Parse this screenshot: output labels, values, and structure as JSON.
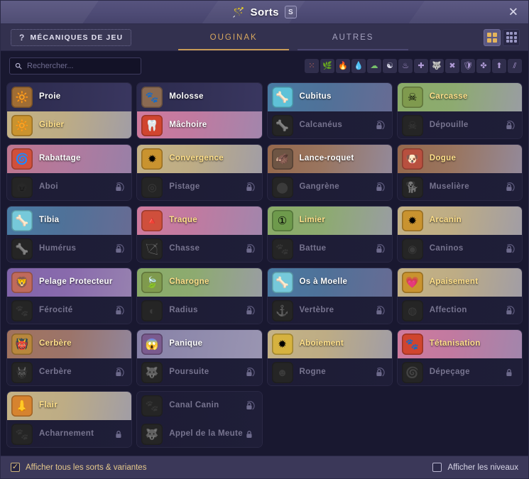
{
  "window": {
    "title": "Sorts",
    "shortcut_key": "S",
    "wand_icon": "magic-wand-icon",
    "close_icon": "✕"
  },
  "tabbar": {
    "mechanics_label": "MÉCANIQUES DE JEU",
    "mechanics_icon": "?",
    "tabs": [
      {
        "label": "OUGINAK",
        "active": true
      },
      {
        "label": "AUTRES",
        "active": false
      }
    ],
    "view_modes": [
      {
        "name": "grid-large-view",
        "active": true
      },
      {
        "name": "grid-small-view",
        "active": false
      }
    ]
  },
  "search": {
    "placeholder": "Rechercher...",
    "value": "",
    "icon": "search-icon"
  },
  "element_filters": [
    {
      "name": "all-elements-filter",
      "glyph": "⁙",
      "color": "#cf6f5a"
    },
    {
      "name": "earth-element-filter",
      "glyph": "🌿",
      "color": "#a98c46"
    },
    {
      "name": "fire-element-filter",
      "glyph": "🔥",
      "color": "#e06a33"
    },
    {
      "name": "water-element-filter",
      "glyph": "💧",
      "color": "#63c8e8"
    },
    {
      "name": "air-element-filter",
      "glyph": "☁",
      "color": "#76c06a"
    },
    {
      "name": "neutral-element-filter",
      "glyph": "☯",
      "color": "#d8d8e8"
    },
    {
      "name": "heal-filter",
      "glyph": "♨",
      "color": "#b09bd6"
    },
    {
      "name": "buff-filter",
      "glyph": "✚",
      "color": "#b09bd6"
    },
    {
      "name": "summon-filter",
      "glyph": "🐺",
      "color": "#b09bd6"
    },
    {
      "name": "debuff-filter",
      "glyph": "✖",
      "color": "#b09bd6"
    },
    {
      "name": "shield-filter",
      "glyph": "🛡",
      "color": "#b09bd6"
    },
    {
      "name": "movement-filter",
      "glyph": "✤",
      "color": "#b09bd6"
    },
    {
      "name": "push-filter",
      "glyph": "⬆",
      "color": "#b09bd6"
    },
    {
      "name": "damage-filter",
      "glyph": "⫽",
      "color": "#b09bd6"
    }
  ],
  "spells": [
    {
      "top": {
        "label": "Proie",
        "unlocked": true,
        "style": "night",
        "icon": "🔆",
        "icon_bg": "#a06d34",
        "gold": false
      },
      "bottom": {
        "label": "Gibier",
        "unlocked": true,
        "style": "sand",
        "icon": "🔆",
        "icon_bg": "#c9932f",
        "gold": true
      }
    },
    {
      "top": {
        "label": "Molosse",
        "unlocked": true,
        "style": "night",
        "icon": "🐾",
        "icon_bg": "#8a6a52",
        "gold": false
      },
      "bottom": {
        "label": "Mâchoire",
        "unlocked": true,
        "style": "pink",
        "icon": "🦷",
        "icon_bg": "#d0452f",
        "gold": false
      }
    },
    {
      "top": {
        "label": "Cubitus",
        "unlocked": true,
        "style": "ice",
        "icon": "🦴",
        "icon_bg": "#5fc2d8",
        "gold": false
      },
      "bottom": {
        "label": "Calcanéus",
        "unlocked": false,
        "style": "dark",
        "icon": "🦴",
        "icon_bg": "#43415f",
        "gold": false
      }
    },
    {
      "top": {
        "label": "Carcasse",
        "unlocked": true,
        "style": "green",
        "icon": "☠",
        "icon_bg": "#7f9a4e",
        "gold": true
      },
      "bottom": {
        "label": "Dépouille",
        "unlocked": false,
        "style": "dark",
        "icon": "☠",
        "icon_bg": "#43415f",
        "gold": false
      }
    },
    {
      "top": {
        "label": "Rabattage",
        "unlocked": true,
        "style": "rose",
        "icon": "🌀",
        "icon_bg": "#d0503c",
        "gold": false
      },
      "bottom": {
        "label": "Aboi",
        "unlocked": false,
        "style": "dark",
        "icon": "😈",
        "icon_bg": "#43415f",
        "gold": false
      }
    },
    {
      "top": {
        "label": "Convergence",
        "unlocked": true,
        "style": "sand",
        "icon": "✹",
        "icon_bg": "#c9932f",
        "gold": true
      },
      "bottom": {
        "label": "Pistage",
        "unlocked": false,
        "style": "dark",
        "icon": "◎",
        "icon_bg": "#43415f",
        "gold": false
      }
    },
    {
      "top": {
        "label": "Lance-roquet",
        "unlocked": true,
        "style": "brown",
        "icon": "🐗",
        "icon_bg": "#6e5544",
        "gold": false
      },
      "bottom": {
        "label": "Gangrène",
        "unlocked": false,
        "style": "dark",
        "icon": "⬤",
        "icon_bg": "#43415f",
        "gold": false
      }
    },
    {
      "top": {
        "label": "Dogue",
        "unlocked": true,
        "style": "brown",
        "icon": "🐶",
        "icon_bg": "#b8503f",
        "gold": true
      },
      "bottom": {
        "label": "Muselière",
        "unlocked": false,
        "style": "dark",
        "icon": "🐕",
        "icon_bg": "#43415f",
        "gold": false
      }
    },
    {
      "top": {
        "label": "Tibia",
        "unlocked": true,
        "style": "ice",
        "icon": "🦴",
        "icon_bg": "#76c9da",
        "gold": false
      },
      "bottom": {
        "label": "Humérus",
        "unlocked": false,
        "style": "dark",
        "icon": "🦴",
        "icon_bg": "#43415f",
        "gold": false
      }
    },
    {
      "top": {
        "label": "Traque",
        "unlocked": true,
        "style": "pink",
        "icon": "🔺",
        "icon_bg": "#cf4f3c",
        "gold": true
      },
      "bottom": {
        "label": "Chasse",
        "unlocked": false,
        "style": "dark",
        "icon": "🏹",
        "icon_bg": "#43415f",
        "gold": false
      }
    },
    {
      "top": {
        "label": "Limier",
        "unlocked": true,
        "style": "green",
        "icon": "①",
        "icon_bg": "#6e9a4c",
        "gold": true
      },
      "bottom": {
        "label": "Battue",
        "unlocked": false,
        "style": "dark",
        "icon": "🐾",
        "icon_bg": "#43415f",
        "gold": false
      }
    },
    {
      "top": {
        "label": "Arcanin",
        "unlocked": true,
        "style": "sand",
        "icon": "✹",
        "icon_bg": "#c9932f",
        "gold": true
      },
      "bottom": {
        "label": "Caninos",
        "unlocked": false,
        "style": "dark",
        "icon": "◉",
        "icon_bg": "#43415f",
        "gold": false
      }
    },
    {
      "top": {
        "label": "Pelage Protecteur",
        "unlocked": true,
        "style": "purple",
        "icon": "🦁",
        "icon_bg": "#c06a5b",
        "gold": false
      },
      "bottom": {
        "label": "Férocité",
        "unlocked": false,
        "style": "dark",
        "icon": "🐾",
        "icon_bg": "#43415f",
        "gold": false
      }
    },
    {
      "top": {
        "label": "Charogne",
        "unlocked": true,
        "style": "green",
        "icon": "🍃",
        "icon_bg": "#7f9a4e",
        "gold": true
      },
      "bottom": {
        "label": "Radius",
        "unlocked": false,
        "style": "dark",
        "icon": "◐",
        "icon_bg": "#43415f",
        "gold": false
      }
    },
    {
      "top": {
        "label": "Os à Moelle",
        "unlocked": true,
        "style": "ice",
        "icon": "🦴",
        "icon_bg": "#76c9da",
        "gold": false
      },
      "bottom": {
        "label": "Vertèbre",
        "unlocked": false,
        "style": "dark",
        "icon": "⚓",
        "icon_bg": "#43415f",
        "gold": false
      }
    },
    {
      "top": {
        "label": "Apaisement",
        "unlocked": true,
        "style": "sand",
        "icon": "💗",
        "icon_bg": "#c9932f",
        "gold": true
      },
      "bottom": {
        "label": "Affection",
        "unlocked": false,
        "style": "dark",
        "icon": "◍",
        "icon_bg": "#43415f",
        "gold": false
      }
    },
    {
      "top": {
        "label": "Cerbère",
        "unlocked": true,
        "style": "copper",
        "icon": "👹",
        "icon_bg": "#b8873c",
        "gold": true
      },
      "bottom": {
        "label": "Cerbère",
        "unlocked": false,
        "style": "dark",
        "icon": "👹",
        "icon_bg": "#43415f",
        "gold": false
      }
    },
    {
      "top": {
        "label": "Panique",
        "unlocked": true,
        "style": "lilac",
        "icon": "😱",
        "icon_bg": "#7a5a8e",
        "gold": false
      },
      "bottom": {
        "label": "Poursuite",
        "unlocked": false,
        "style": "dark",
        "icon": "🐺",
        "icon_bg": "#43415f",
        "gold": false
      }
    },
    {
      "top": {
        "label": "Aboiement",
        "unlocked": true,
        "style": "sand",
        "icon": "✹",
        "icon_bg": "#d6b23f",
        "gold": true
      },
      "bottom": {
        "label": "Rogne",
        "unlocked": false,
        "style": "dark",
        "icon": "☻",
        "icon_bg": "#43415f",
        "gold": false
      }
    },
    {
      "top": {
        "label": "Tétanisation",
        "unlocked": true,
        "style": "pink",
        "icon": "🐾",
        "icon_bg": "#d0452f",
        "gold": true
      },
      "bottom": {
        "label": "Dépeçage",
        "unlocked": false,
        "style": "dark",
        "icon": "🌀",
        "icon_bg": "#43415f",
        "gold": false,
        "lock_full": true
      }
    },
    {
      "top": {
        "label": "Flair",
        "unlocked": true,
        "style": "sand",
        "icon": "👃",
        "icon_bg": "#d6832f",
        "gold": true
      },
      "bottom": {
        "label": "Acharnement",
        "unlocked": false,
        "style": "dark",
        "icon": "🐾",
        "icon_bg": "#43415f",
        "gold": false,
        "lock_full": true
      }
    },
    {
      "top": {
        "label": "Canal Canin",
        "unlocked": false,
        "style": "dark",
        "icon": "🐾",
        "icon_bg": "#43415f",
        "gold": false
      },
      "bottom": {
        "label": "Appel de la Meute",
        "unlocked": false,
        "style": "dark",
        "icon": "🐺",
        "icon_bg": "#43415f",
        "gold": false,
        "lock_full": true
      }
    }
  ],
  "footer": {
    "left_checkbox": {
      "label": "Afficher tous les sorts & variantes",
      "checked": true,
      "mark": "✓"
    },
    "right_checkbox": {
      "label": "Afficher les niveaux",
      "checked": false,
      "mark": ""
    }
  }
}
